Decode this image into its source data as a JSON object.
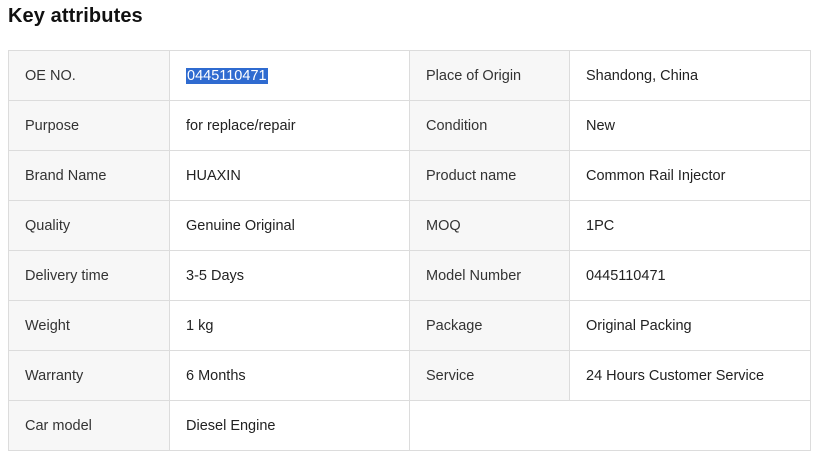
{
  "section": {
    "title": "Key attributes"
  },
  "attributes": [
    {
      "k1": "OE NO.",
      "v1": "0445110471",
      "k2": "Place of Origin",
      "v2": "Shandong, China"
    },
    {
      "k1": "Purpose",
      "v1": "for replace/repair",
      "k2": "Condition",
      "v2": "New"
    },
    {
      "k1": "Brand Name",
      "v1": "HUAXIN",
      "k2": "Product name",
      "v2": "Common Rail Injector"
    },
    {
      "k1": "Quality",
      "v1": "Genuine Original",
      "k2": "MOQ",
      "v2": "1PC"
    },
    {
      "k1": "Delivery time",
      "v1": "3-5 Days",
      "k2": "Model Number",
      "v2": "0445110471"
    },
    {
      "k1": "Weight",
      "v1": "1 kg",
      "k2": "Package",
      "v2": "Original Packing"
    },
    {
      "k1": "Warranty",
      "v1": "6 Months",
      "k2": "Service",
      "v2": "24 Hours Customer Service"
    },
    {
      "k1": "Car model",
      "v1": "Diesel Engine"
    }
  ],
  "colors": {
    "selection": "#2f6bd0",
    "key_bg": "#f7f7f7",
    "border": "#dcdcdc"
  }
}
